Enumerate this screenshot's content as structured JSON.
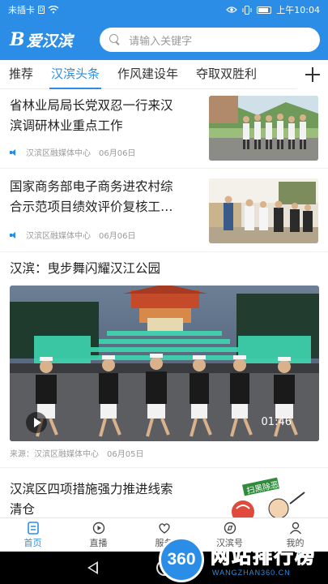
{
  "status_bar": {
    "carrier": "未插卡",
    "sim_glyph": "D",
    "time": "上午10:04"
  },
  "header": {
    "logo_mark": "B",
    "logo_text": "爱汉滨",
    "search_placeholder": "请输入关键字",
    "brand_color": "#2c8de6"
  },
  "tabs": [
    {
      "label": "推荐",
      "active": false
    },
    {
      "label": "汉滨头条",
      "active": true
    },
    {
      "label": "作风建设年",
      "active": false
    },
    {
      "label": "夺取双胜利",
      "active": false
    }
  ],
  "news": [
    {
      "title_line1": "省林业局局长党双忍一行来汉",
      "title_line2": "滨调研林业重点工作",
      "source": "汉滨区融媒体中心",
      "date": "06月06日"
    },
    {
      "title_line1": "国家商务部电子商务进农村综",
      "title_line2": "合示范项目绩效评价复核工…",
      "source": "汉滨区融媒体中心",
      "date": "06月06日"
    }
  ],
  "video": {
    "title": "汉滨：曳步舞闪耀汉江公园",
    "duration": "01:46",
    "source": "来源：汉滨区融媒体中心",
    "date": "06月05日"
  },
  "partial_news": {
    "title_line1": "汉滨区四项措施强力推进线索",
    "title_line2": "清仓",
    "thumb_banner": "扫黑除恶"
  },
  "tabbar": [
    {
      "label": "首页",
      "icon": "home-icon",
      "active": true
    },
    {
      "label": "直播",
      "icon": "live-icon",
      "active": false
    },
    {
      "label": "服务",
      "icon": "service-icon",
      "active": false
    },
    {
      "label": "汉滨号",
      "icon": "compass-icon",
      "active": false
    },
    {
      "label": "我的",
      "icon": "profile-icon",
      "active": false
    }
  ],
  "watermark": {
    "badge": "360",
    "title": "网站排行榜",
    "sub": "WANGZHAN360.CN"
  }
}
